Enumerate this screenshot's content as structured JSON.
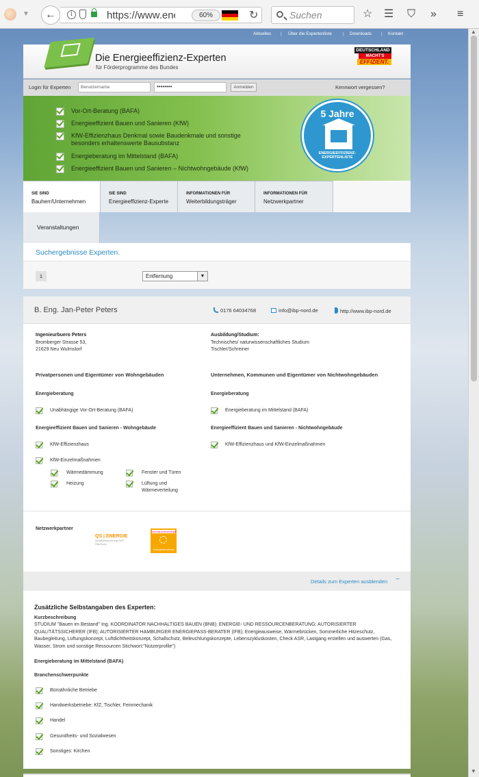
{
  "browser": {
    "url": "https://www.enei",
    "zoom": "60%",
    "search_placeholder": "Suchen"
  },
  "top_links": [
    "Aktuelles",
    "Über die Expertenliste",
    "Downloads",
    "Kontakt"
  ],
  "header": {
    "title": "Die Energieeffizienz-Experten",
    "subtitle": "für Förderprogramme des Bundes",
    "logo_line1": "DEUTSCHLAND",
    "logo_line2": "MACHT'S",
    "logo_line3": "EFFIZIENT."
  },
  "login": {
    "label": "Login für Experten",
    "username_placeholder": "Benutzername",
    "password_value": "••••••••",
    "button": "Anmelden",
    "forgot": "Kennwort vergessen?"
  },
  "hero": {
    "items": [
      "Vor-Ort-Beratung (BAFA)",
      "Energieeffizient Bauen und Sanieren (KfW)",
      "KfW-Effizienzhaus Denkmal sowie Baudenkmale und sonstige besonders erhaltenswerte Bausubstanz",
      "Energieberatung im Mittelstand (BAFA)",
      "Energieeffizient Bauen und Sanieren – Nichtwohngebäude (KfW)"
    ],
    "badge_title": "5 Jahre",
    "badge_ring": "ENERGIEEFFIZIENZ-EXPERTENLISTE"
  },
  "tabs": [
    {
      "top": "SIE SIND",
      "bottom": "Bauherr/Unternehmen"
    },
    {
      "top": "SIE SIND",
      "bottom": "Energieeffizienz-Experte"
    },
    {
      "top": "INFORMATIONEN FÜR",
      "bottom": "Weiterbildungsträger"
    },
    {
      "top": "INFORMATIONEN FÜR",
      "bottom": "Netzwerkpartner"
    }
  ],
  "tab_events": "Veranstaltungen",
  "results": {
    "title": "Suchergebnisse Experten.",
    "page": "1",
    "sort": "Entfernung"
  },
  "expert": {
    "name": "B. Eng.  Jan-Peter Peters",
    "phone": "0176 64034768",
    "email": "info@ibp-nord.de",
    "web": "http://www.ibp-nord.de",
    "company": "Ingenieurbuero Peters",
    "street": "Bromberger Strasse 53,",
    "city": "21629 Neu Wulmstorf",
    "education_label": "Ausbildung/Studium:",
    "education1": "Technisches/ naturwissenschaftliches Studium",
    "education2": "Tischler/Schreiner",
    "left_col": {
      "title": "Privatpersonen und Eigentümer von Wohngebäuden",
      "section1": "Energieberatung",
      "item1": "Unabhängige Vor-Ort-Beratung (BAFA)",
      "section2": "Energieeffizient Bauen und Sanieren - Wohngebäude",
      "item2": "KfW-Effizienzhaus",
      "item3": "KfW-Einzelmaßnahmen",
      "sub": [
        "Wärmedämmung",
        "Fenster und Türen",
        "Heizung",
        "Lüftung und Wärmeverteilung"
      ]
    },
    "right_col": {
      "title": "Unternehmen, Kommunen und Eigentümer von Nichtwohngebäuden",
      "section1": "Energieberatung",
      "item1": "Energieberatung im Mittelstand (BAFA)",
      "section2": "Energieeffizient Bauen und Sanieren - Nichtwohngebäude",
      "item2": "KfW-Effizienzhaus und KfW-Einzelmaßnahmen"
    },
    "network_label": "Netzwerkpartner",
    "qs_logo": "QS | ENERGIE",
    "qs_sub": "Qualitätssicherung EEP Hamburg",
    "vz_top": "verbraucherzentrale",
    "vz_bottom": "Energieberatung",
    "details_toggle": "Details zum Experten ausblenden",
    "details_symbol": "−",
    "extra_title": "Zusätzliche Selbstangaben des Experten:",
    "desc_title": "Kurzbeschreibung",
    "desc_text": "STUDIUM \"Bauen im Bestand\" Ing. KOORDINATOR NACHHALTIGES BAUEN (BNB); ENERGIE- UND RESSOURCENBERATUNG; AUTORISIERTER QUALITÄTSSICHERER (IFB); AUTORISIERTER HAMBURGER ENERGIEPASS-BERATER (IFB); Energieausweise, Wärmebrücken, Sommerliche Hitzeschutz, Baubegleitung, Lüftungskonzept, Luftdichtheitskonzept, Schallschutz, Beleuchtungskonzepte, Lebenszykluskosten, Check ASR, Lastgang erstellen und auswerten (Gas, Wasser, Strom und sonstige Ressourcen Stichwort:\"Nutzerprofile\")",
    "mittelstand_title": "Energieberatung im Mittelstand (BAFA)",
    "branchen_title": "Branchenschwerpunkte",
    "branchen": [
      "Büroähnliche Betriebe",
      "Handwerksbetriebe: KfZ, Tischler, Feinmechanik",
      "Handel",
      "Gesundheits- und Sozialwesen",
      "Sonstiges: Kirchen"
    ]
  }
}
